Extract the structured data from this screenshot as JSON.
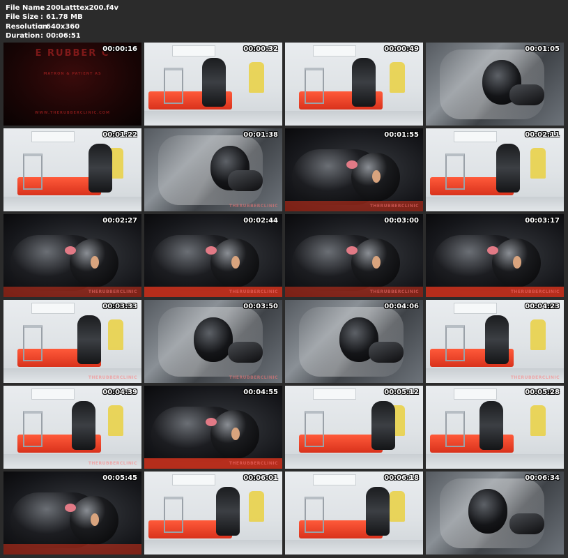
{
  "file_info": [
    {
      "label": "File Name",
      "value": "200Latttex200.f4v"
    },
    {
      "label": "File Size",
      "value": "61.78 MB"
    },
    {
      "label": "Resolution",
      "value": "640x360"
    },
    {
      "label": "Duration",
      "value": "00:06:51"
    }
  ],
  "separator": ":",
  "intro": {
    "title": "E RUBBER C",
    "subtitle": "MATRON & PATIENT AS",
    "url": "WWW.THERUBBERCLINIC.COM"
  },
  "watermark": "THERUBBERCLINIC",
  "thumbnails": [
    {
      "time": "00:00:16",
      "scene": "intro",
      "watermark": false
    },
    {
      "time": "00:00:32",
      "scene": "room",
      "watermark": false
    },
    {
      "time": "00:00:49",
      "scene": "room",
      "watermark": false
    },
    {
      "time": "00:01:05",
      "scene": "plastic",
      "watermark": false
    },
    {
      "time": "00:01:22",
      "scene": "room",
      "watermark": false
    },
    {
      "time": "00:01:38",
      "scene": "plastic",
      "watermark": true
    },
    {
      "time": "00:01:55",
      "scene": "dark",
      "watermark": true
    },
    {
      "time": "00:02:11",
      "scene": "room",
      "watermark": false
    },
    {
      "time": "00:02:27",
      "scene": "dark",
      "watermark": true
    },
    {
      "time": "00:02:44",
      "scene": "dark",
      "watermark": true
    },
    {
      "time": "00:03:00",
      "scene": "dark",
      "watermark": true
    },
    {
      "time": "00:03:17",
      "scene": "dark",
      "watermark": true
    },
    {
      "time": "00:03:33",
      "scene": "room",
      "watermark": true
    },
    {
      "time": "00:03:50",
      "scene": "plastic",
      "watermark": true
    },
    {
      "time": "00:04:06",
      "scene": "plastic",
      "watermark": false
    },
    {
      "time": "00:04:23",
      "scene": "room",
      "watermark": true
    },
    {
      "time": "00:04:39",
      "scene": "room",
      "watermark": true
    },
    {
      "time": "00:04:55",
      "scene": "dark",
      "watermark": true
    },
    {
      "time": "00:05:12",
      "scene": "room",
      "watermark": false
    },
    {
      "time": "00:05:28",
      "scene": "room",
      "watermark": false
    },
    {
      "time": "00:05:45",
      "scene": "dark",
      "watermark": false
    },
    {
      "time": "00:06:01",
      "scene": "room",
      "watermark": false
    },
    {
      "time": "00:06:18",
      "scene": "room",
      "watermark": false
    },
    {
      "time": "00:06:34",
      "scene": "plastic",
      "watermark": false
    }
  ]
}
